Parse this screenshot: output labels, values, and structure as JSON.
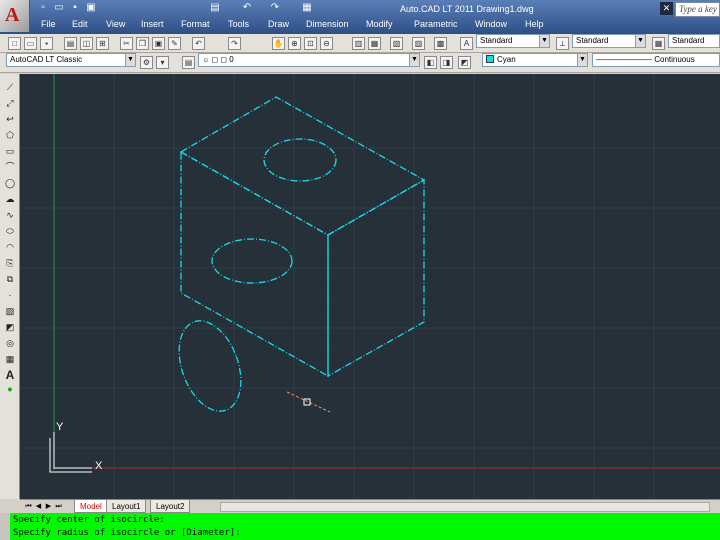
{
  "app": {
    "window_title": "Auto.CAD LT 2011    Drawing1.dwg",
    "help_search_placeholder": "Type a key"
  },
  "menu": [
    "File",
    "Edit",
    "View",
    "Insert",
    "Format",
    "Tools",
    "Draw",
    "Dimension",
    "Modify",
    "Parametric",
    "Window",
    "Help"
  ],
  "toolbar1": {
    "text_style": "Standard",
    "dim_style": "Standard",
    "table_style": "Standard"
  },
  "toolbar2": {
    "workspace": "AutoCAD LT Classic",
    "layer": "0",
    "color": "Cyan",
    "linetype": "Continuous"
  },
  "colors": {
    "canvas_bg": "#263038",
    "geometry": "#1ad8e8",
    "command_bg": "#00f800"
  },
  "ucs": {
    "x_label": "X",
    "y_label": "Y"
  },
  "layout_tabs": [
    "Model",
    "Layout1",
    "Layout2"
  ],
  "command_lines": [
    "Specify center of isocircle:",
    "Specify radius of isocircle or [Diameter]:"
  ]
}
